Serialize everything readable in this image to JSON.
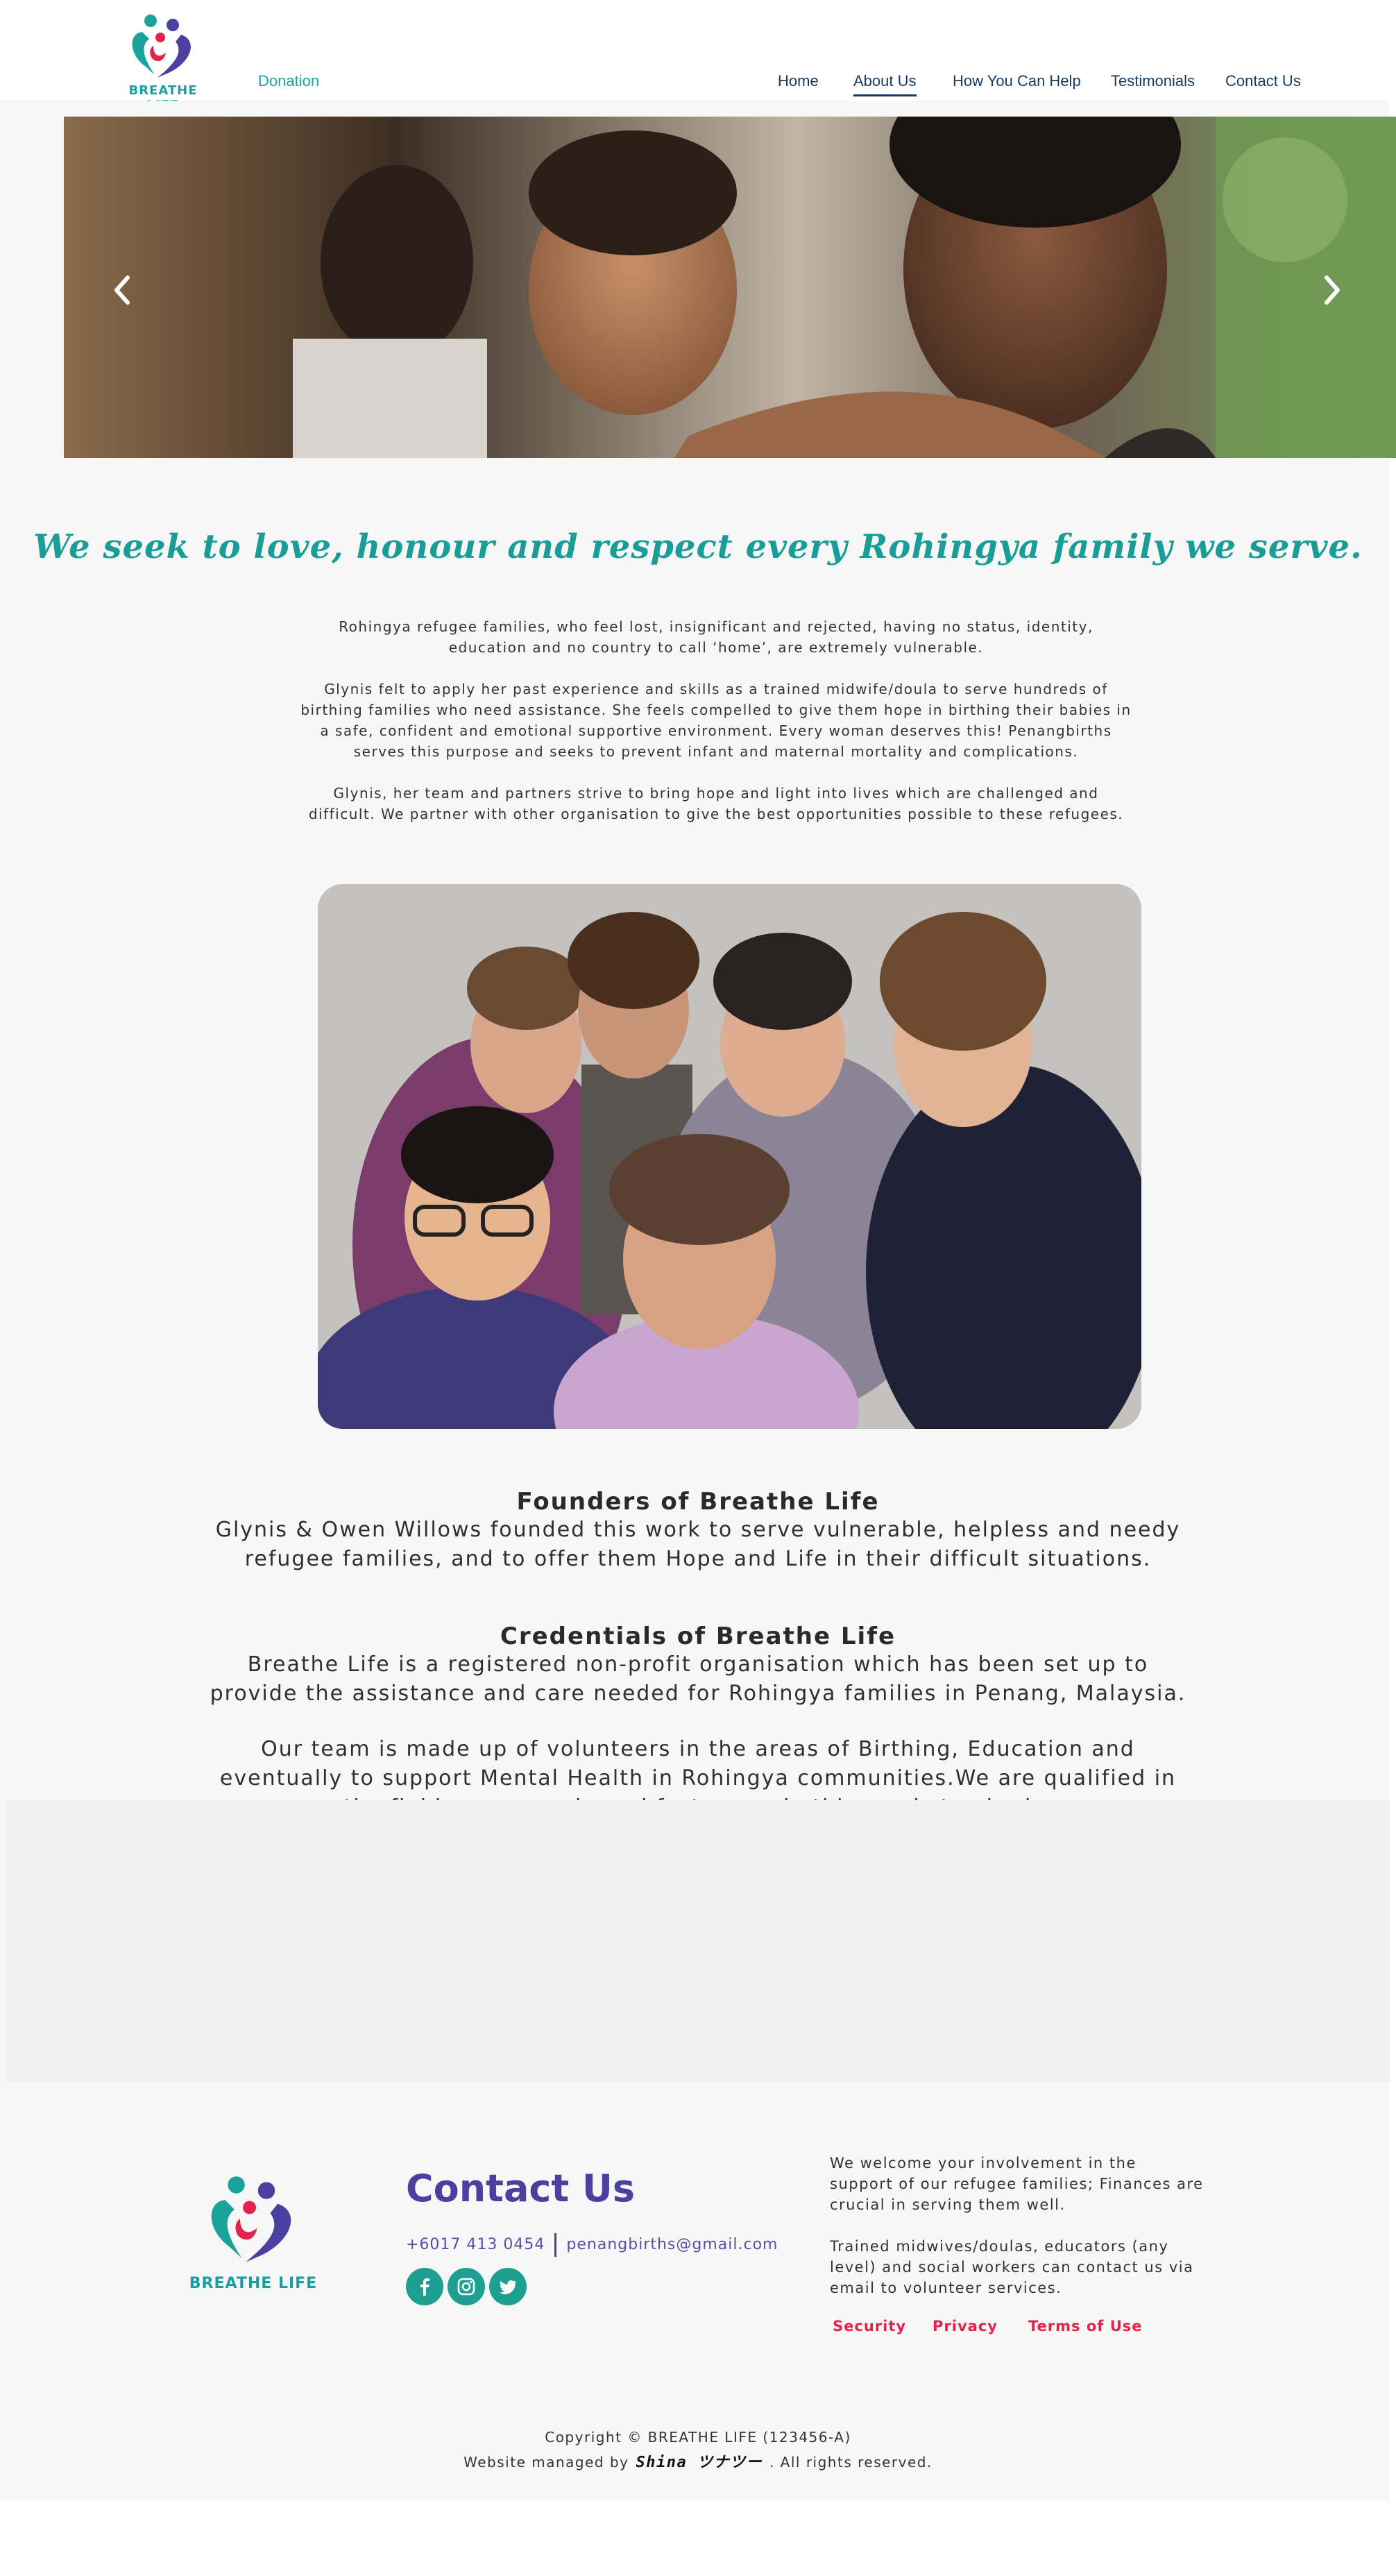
{
  "header": {
    "brand": "BREATHE LIFE",
    "donation_label": "Donation",
    "nav": [
      {
        "label": "Home"
      },
      {
        "label": "About Us",
        "active": true
      },
      {
        "label": "How You Can Help"
      },
      {
        "label": "Testimonials"
      },
      {
        "label": "Contact Us"
      }
    ]
  },
  "hero": {
    "prev_icon": "chevron-left-icon",
    "next_icon": "chevron-right-icon"
  },
  "main": {
    "tagline": "We seek to love, honour and respect every Rohingya family we serve.",
    "intro_paragraphs": [
      "Rohingya refugee families, who feel lost, insignificant and rejected, having no status, identity, education and no country to call ‘home’, are extremely vulnerable.",
      "Glynis felt to apply her past experience and skills as a trained midwife/doula to serve hundreds of birthing families who need assistance. She feels compelled to give them hope in birthing their babies in a safe, confident and emotional supportive environment. Every woman deserves this! Penangbirths serves this purpose and seeks to prevent infant and maternal mortality and complications.",
      "Glynis, her team and partners strive to bring hope and light into lives which are challenged and difficult.  We partner with other organisation to give the best opportunities possible to these refugees."
    ],
    "founders": {
      "heading": "Founders of Breathe Life",
      "text": "Glynis & Owen Willows founded this work to serve vulnerable, helpless and needy refugee families, and to offer them Hope and Life in their difficult situations."
    },
    "credentials": {
      "heading": "Credentials of Breathe Life",
      "text1": "Breathe Life is a registered non-profit organisation which has been set up to provide the assistance and care needed for Rohingya families in Penang, Malaysia.",
      "text2": "Our team is made up of volunteers in the areas of Birthing, Education and eventually to support Mental Health in Rohingya communities.We are qualified in the fields we serve in and foster good ethics and standards."
    }
  },
  "footer": {
    "brand": "BREATHE LIFE",
    "contact_title": "Contact Us",
    "phone": "+6017 413 0454",
    "email": "penangbirths@gmail.com",
    "social_icons": [
      "facebook-icon",
      "instagram-icon",
      "twitter-icon"
    ],
    "text1": "We welcome your involvement in the support of our refugee families; Finances are crucial in serving them well.",
    "text2": "Trained midwives/doulas, educators (any level) and social workers can contact us via email to volunteer services.",
    "links": [
      "Security",
      "Privacy",
      "Terms of Use"
    ],
    "copyright": "Copyright © BREATHE LIFE (123456-A)",
    "managed_prefix": "Website managed by",
    "managed_brand": "Shina ツナツー",
    "managed_suffix": ". All rights reserved."
  },
  "colors": {
    "teal": "#1a9d96",
    "navy": "#173b5e",
    "purple": "#4b3fa0",
    "red": "#e2234a"
  }
}
